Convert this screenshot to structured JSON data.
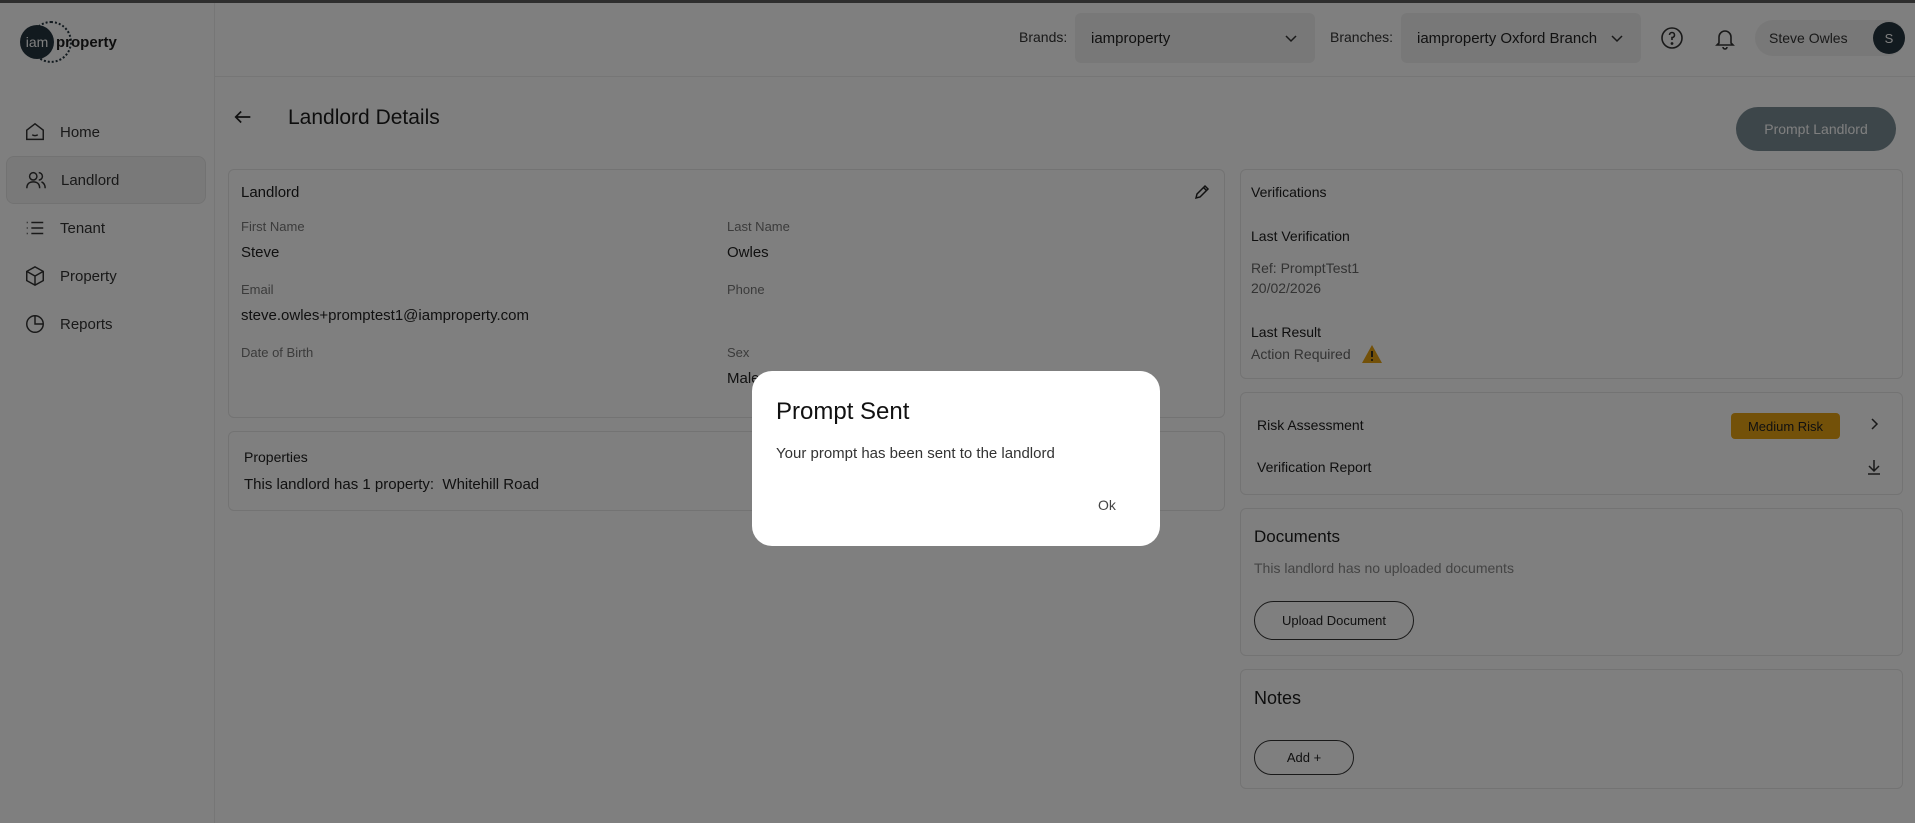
{
  "app": {
    "logo_mark": "iam",
    "logo_text": "property"
  },
  "sidebar": {
    "items": [
      {
        "label": "Home",
        "icon": "home-icon",
        "active": false
      },
      {
        "label": "Landlord",
        "icon": "users-icon",
        "active": true
      },
      {
        "label": "Tenant",
        "icon": "list-icon",
        "active": false
      },
      {
        "label": "Property",
        "icon": "box-icon",
        "active": false
      },
      {
        "label": "Reports",
        "icon": "pie-chart-icon",
        "active": false
      }
    ]
  },
  "header": {
    "brands_label": "Brands:",
    "brands_value": "iamproperty",
    "branches_label": "Branches:",
    "branches_value": "iamproperty Oxford Branch",
    "user_name": "Steve Owles",
    "avatar_initial": "S"
  },
  "page": {
    "title": "Landlord Details",
    "prompt_button": "Prompt Landlord"
  },
  "landlord_card": {
    "title": "Landlord",
    "first_name_label": "First Name",
    "first_name": "Steve",
    "last_name_label": "Last Name",
    "last_name": "Owles",
    "email_label": "Email",
    "email": "steve.owles+promptest1@iamproperty.com",
    "phone_label": "Phone",
    "phone": "",
    "dob_label": "Date of Birth",
    "dob": "",
    "sex_label": "Sex",
    "sex": "Male"
  },
  "properties_card": {
    "title": "Properties",
    "text": "This landlord has 1 property:  Whitehill Road"
  },
  "verifications": {
    "title": "Verifications",
    "last_verification_label": "Last Verification",
    "ref": "Ref: PromptTest1",
    "date": "20/02/2026",
    "last_result_label": "Last Result",
    "last_result": "Action Required"
  },
  "risk": {
    "label": "Risk Assessment",
    "badge": "Medium Risk",
    "badge_color": "#e6a313",
    "report_label": "Verification Report"
  },
  "documents": {
    "title": "Documents",
    "empty_text": "This landlord has no uploaded documents",
    "upload_button": "Upload Document"
  },
  "notes": {
    "title": "Notes",
    "add_button": "Add +"
  },
  "modal": {
    "title": "Prompt Sent",
    "message": "Your prompt has been sent to the landlord",
    "ok": "Ok"
  }
}
